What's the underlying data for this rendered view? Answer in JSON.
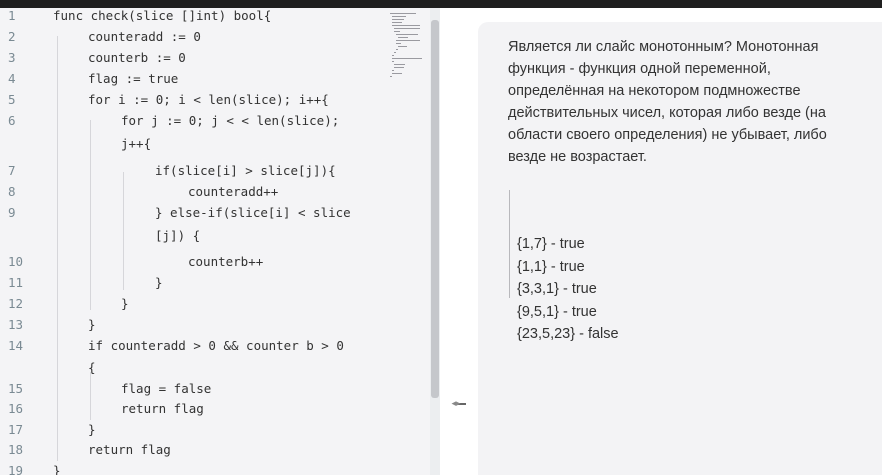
{
  "editor": {
    "lines": [
      {
        "num": "1",
        "text": "func check(slice []int) bool{"
      },
      {
        "num": "2",
        "text": "counteradd := 0"
      },
      {
        "num": "3",
        "text": "counterb := 0"
      },
      {
        "num": "4",
        "text": "flag := true"
      },
      {
        "num": "5",
        "text": "for i := 0; i < len(slice); i++{"
      },
      {
        "num": "6",
        "text": "for j := 0; j < < len(slice);"
      },
      {
        "num": "",
        "text": "j++{"
      },
      {
        "num": "7",
        "text": "if(slice[i] > slice[j]){"
      },
      {
        "num": "8",
        "text": "counteradd++"
      },
      {
        "num": "9",
        "text": "} else-if(slice[i] < slice"
      },
      {
        "num": "",
        "text": "[j]) {"
      },
      {
        "num": "10",
        "text": "counterb++"
      },
      {
        "num": "11",
        "text": "}"
      },
      {
        "num": "12",
        "text": "}"
      },
      {
        "num": "13",
        "text": "}"
      },
      {
        "num": "14",
        "text": "if counteradd > 0 && counter b > 0"
      },
      {
        "num": "",
        "text": "{"
      },
      {
        "num": "15",
        "text": "flag = false"
      },
      {
        "num": "16",
        "text": "return flag"
      },
      {
        "num": "17",
        "text": "}"
      },
      {
        "num": "18",
        "text": "return flag"
      },
      {
        "num": "19",
        "text": "}"
      }
    ]
  },
  "task": {
    "description": "Является ли слайс монотонным?\nМонотонная функция - функция одной переменной, определённая на некотором подмножестве действительных чисел, которая либо везде (на области своего определения) не убывает, либо везде не возрастает.",
    "examples": [
      "{1,7} - true",
      "{1,1} - true",
      "{3,3,1} - true",
      "{9,5,1} - true",
      "{23,5,23} - false"
    ]
  },
  "icons": {
    "splitter": "resize-horizontal-icon"
  }
}
